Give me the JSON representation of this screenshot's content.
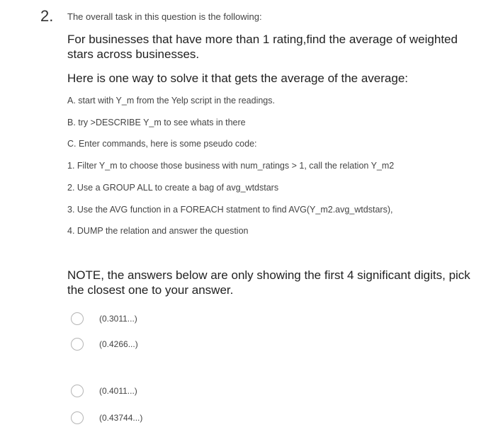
{
  "question": {
    "number": "2.",
    "intro": "The overall task in this question is the following:",
    "lead": "For businesses that have more than 1 rating,find the average of weighted stars across businesses.",
    "method": "Here is one way to solve it that gets the average of the average:",
    "steps": [
      "A. start with Y_m from the Yelp script in the readings.",
      "B. try >DESCRIBE Y_m to see whats in there",
      "C. Enter commands, here is some pseudo code:",
      "1. Filter Y_m to choose those business with num_ratings > 1, call the relation Y_m2",
      "2. Use a GROUP ALL to create a bag of avg_wtdstars",
      "3. Use the AVG function in a FOREACH statment to find AVG(Y_m2.avg_wtdstars),",
      "4. DUMP the relation and answer the question"
    ],
    "note": "NOTE, the answers below are only showing the first 4 significant digits, pick the closest one to your answer."
  },
  "options": [
    {
      "label": "(0.3011...)",
      "selected": false
    },
    {
      "label": "(0.4266...)",
      "selected": false
    },
    {
      "label": "(0.4011...)",
      "selected": false
    },
    {
      "label": "(0.43744...)",
      "selected": false
    }
  ]
}
